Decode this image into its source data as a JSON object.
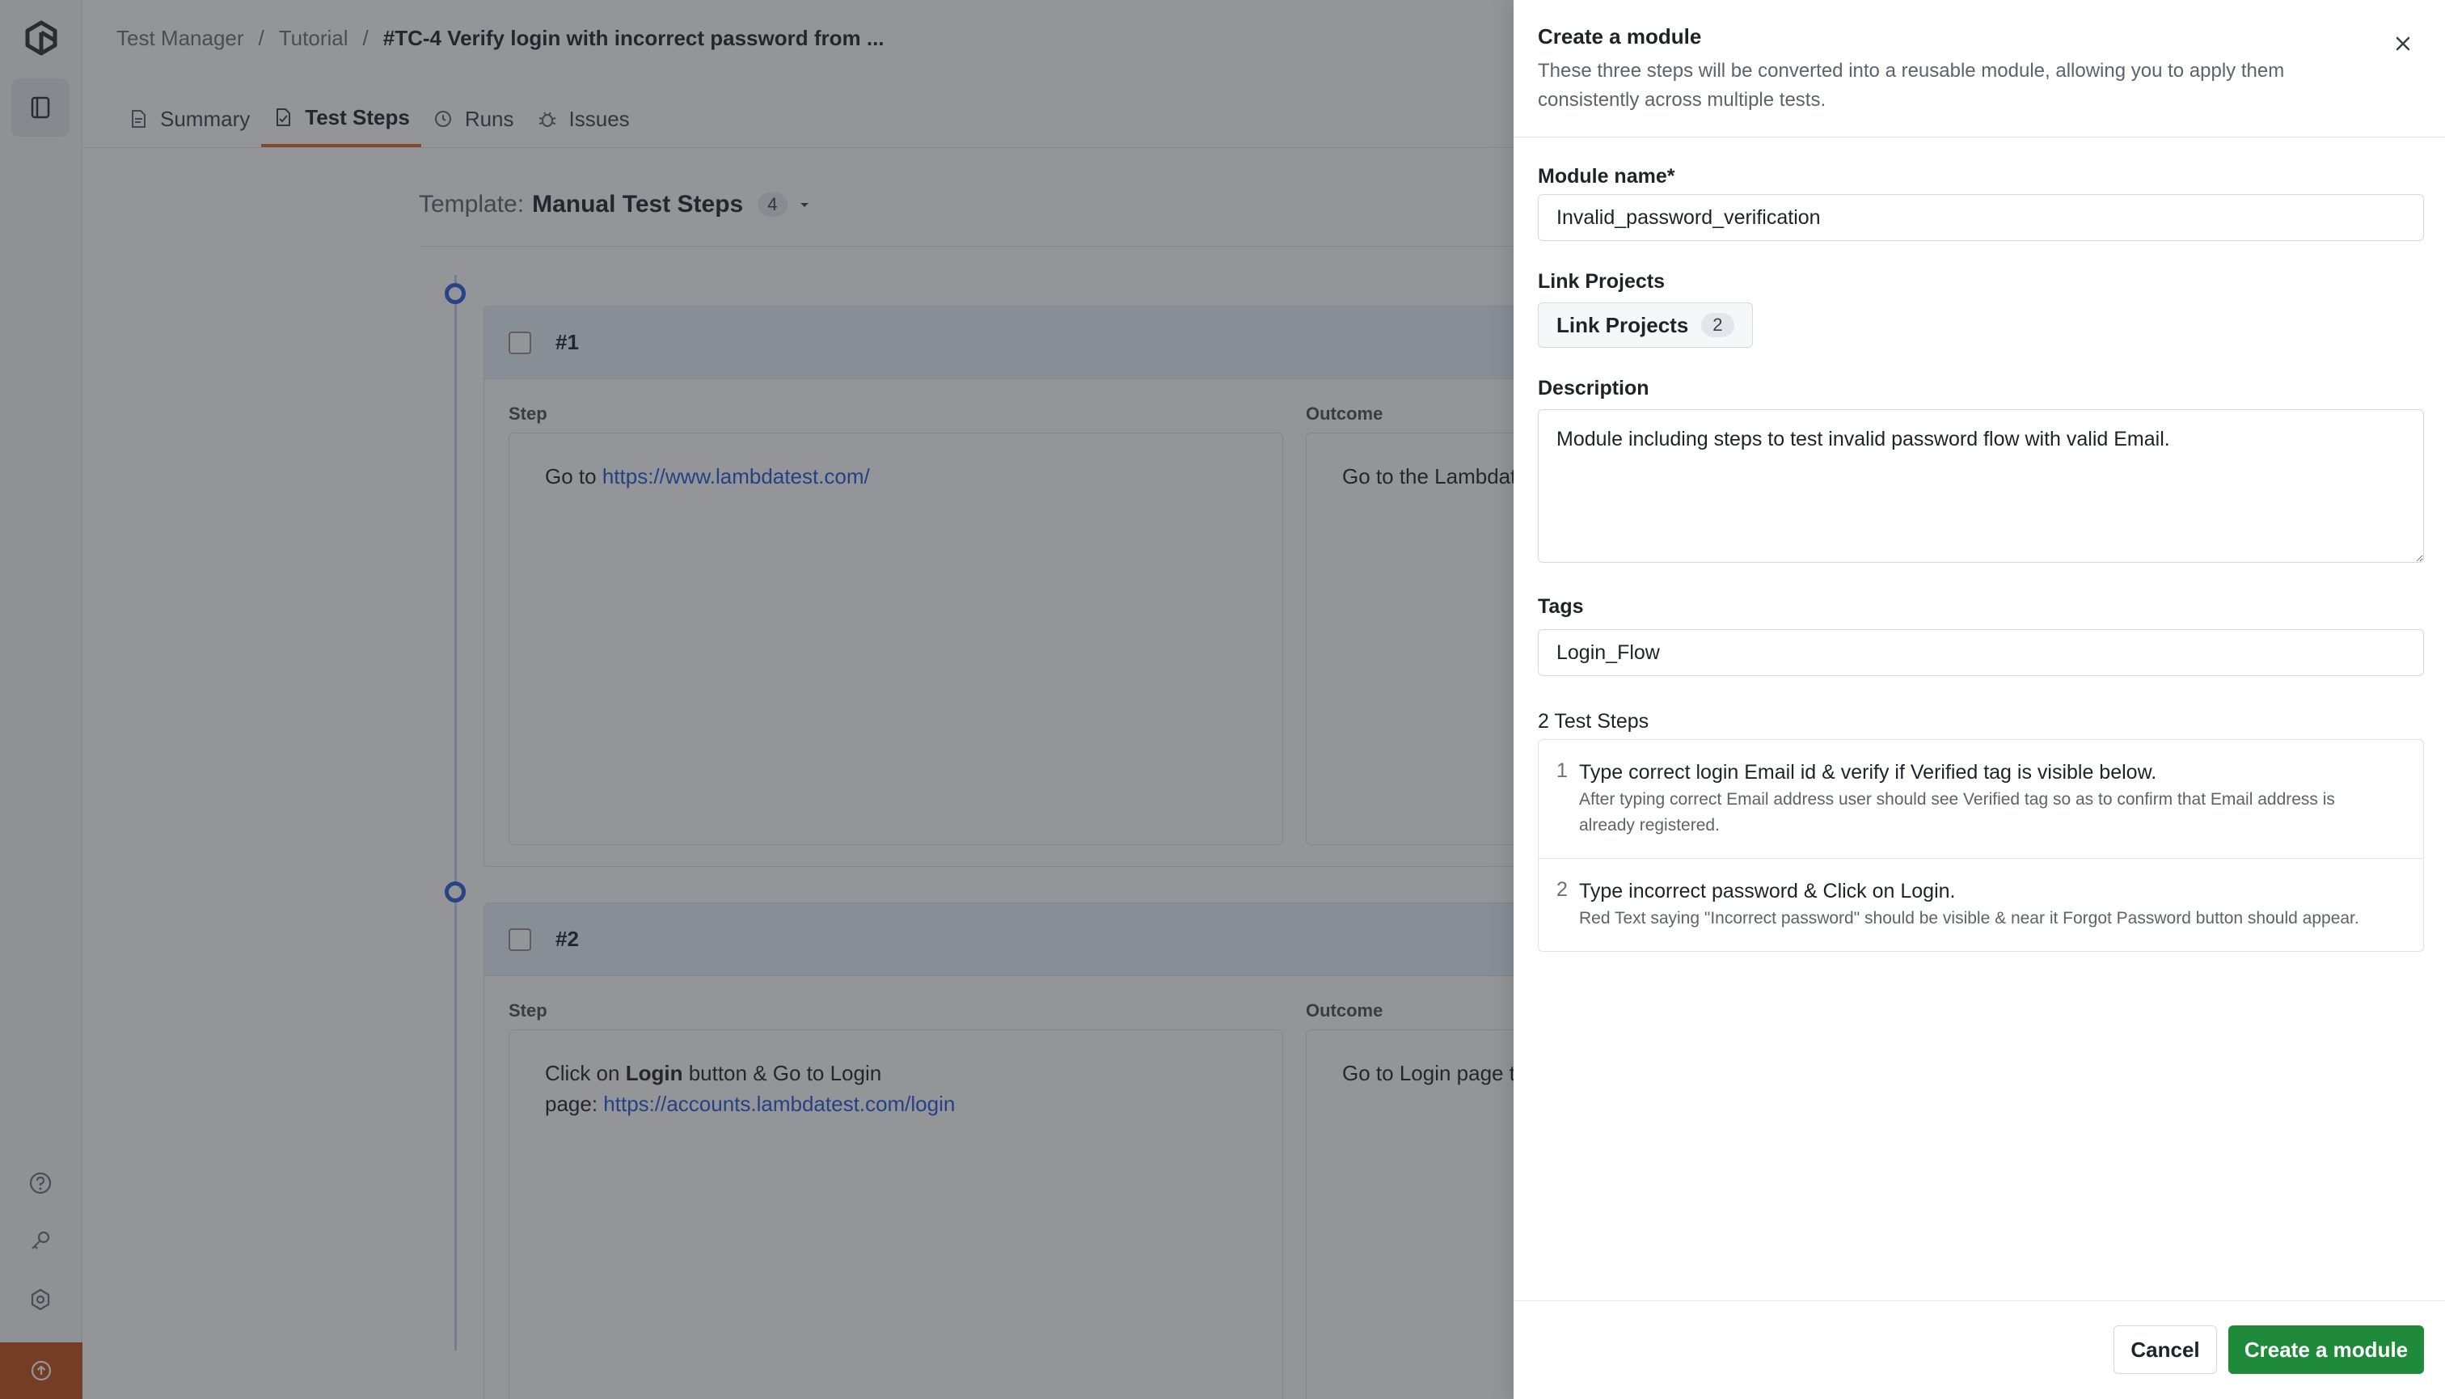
{
  "breadcrumb": {
    "items": [
      "Test Manager",
      "/",
      "Tutorial",
      "/"
    ],
    "current": "#TC-4 Verify login with incorrect password from ..."
  },
  "tabs": [
    {
      "label": "Summary",
      "icon": "document-icon"
    },
    {
      "label": "Test Steps",
      "icon": "steps-icon"
    },
    {
      "label": "Runs",
      "icon": "history-icon"
    },
    {
      "label": "Issues",
      "icon": "bug-icon"
    }
  ],
  "template": {
    "prefix": "Template:",
    "name": "Manual Test Steps",
    "count": "4"
  },
  "steps": [
    {
      "id": "#1",
      "step_label": "Step",
      "outcome_label": "Outcome",
      "step_text": "Go to ",
      "step_link": "https://www.lambdatest.com/",
      "outcome_text": "Go to the Lambdate"
    },
    {
      "id": "#2",
      "step_label": "Step",
      "outcome_label": "Outcome",
      "step_text_1": "Click on ",
      "step_bold": "Login",
      "step_text_2": " button & Go to Login",
      "step_text_3": "page: ",
      "step_link": "https://accounts.lambdatest.com/login",
      "outcome_text": "Go to Login page th"
    }
  ],
  "drawer": {
    "title": "Create a module",
    "subtitle": "These three steps will be converted into a reusable module, allowing you to apply them consistently across multiple tests.",
    "module_name_label": "Module name*",
    "module_name_value": "Invalid_password_verification",
    "link_projects_label": "Link Projects",
    "link_projects_button": "Link Projects",
    "link_projects_count": "2",
    "description_label": "Description",
    "description_value": "Module including steps to test invalid password flow with valid Email.",
    "tags_label": "Tags",
    "tags_value": "Login_Flow",
    "test_steps_label": "2 Test Steps",
    "test_steps": [
      {
        "num": "1",
        "title": "Type correct login Email id & verify if Verified tag is visible below.",
        "detail": "After typing correct Email address user should see Verified tag so as to confirm that Email address is already registered."
      },
      {
        "num": "2",
        "title": "Type incorrect password & Click on Login.",
        "detail": "Red Text saying \"Incorrect password\" should be visible & near it Forgot Password button should appear."
      }
    ],
    "cancel_label": "Cancel",
    "create_label": "Create a module"
  },
  "colors": {
    "accent_tab": "#d9662b",
    "primary_button": "#1f8a3a",
    "link": "#1f56d4",
    "rail_bottom": "#c14e17"
  }
}
